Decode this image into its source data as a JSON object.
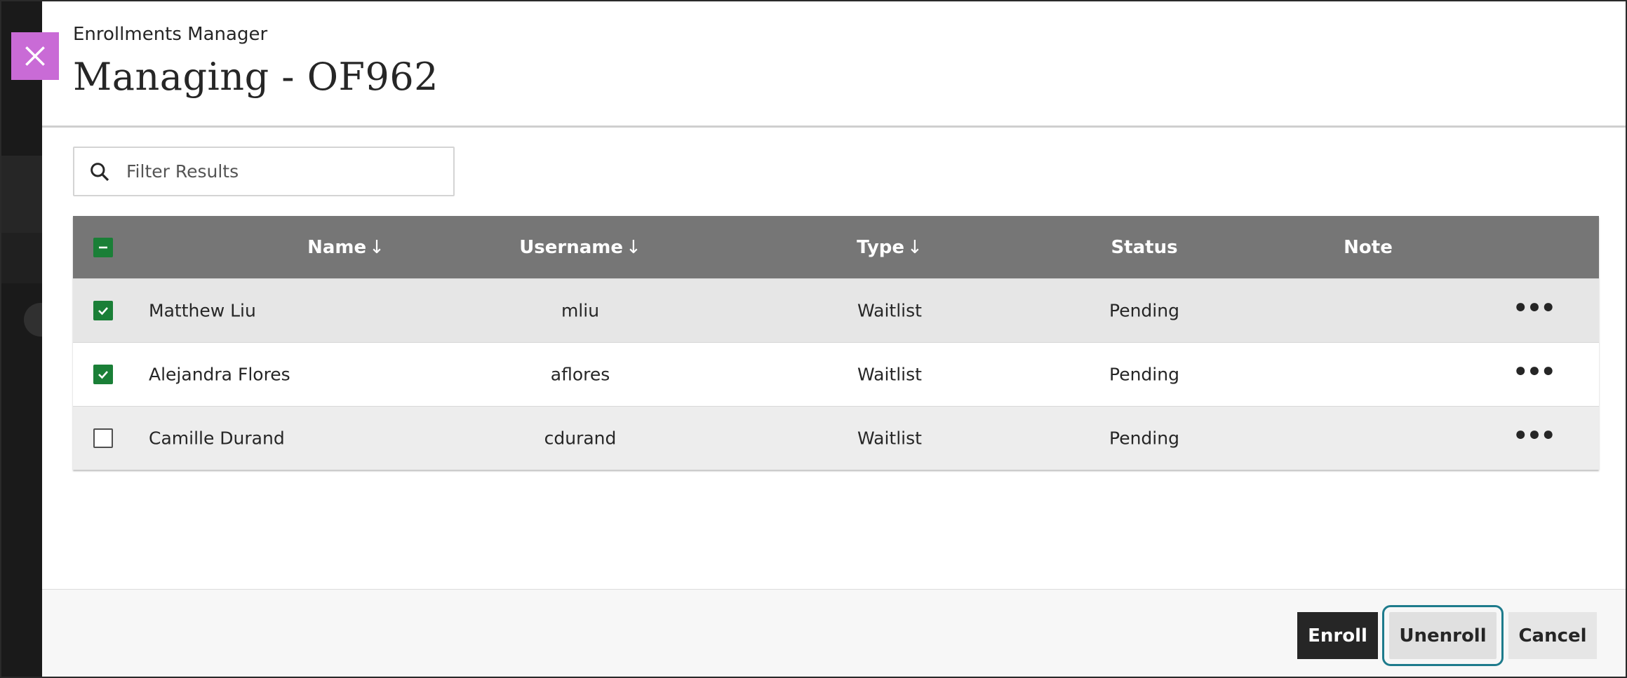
{
  "header": {
    "subtitle": "Enrollments Manager",
    "title": "Managing - OF962"
  },
  "filter": {
    "placeholder": "Filter Results",
    "value": ""
  },
  "table": {
    "columns": {
      "name": "Name",
      "username": "Username",
      "type": "Type",
      "status": "Status",
      "note": "Note"
    },
    "sort_arrow": "↓",
    "select_all_state": "indeterminate",
    "rows": [
      {
        "checked": true,
        "name": "Matthew Liu",
        "username": "mliu",
        "type": "Waitlist",
        "status": "Pending"
      },
      {
        "checked": true,
        "name": "Alejandra Flores",
        "username": "aflores",
        "type": "Waitlist",
        "status": "Pending"
      },
      {
        "checked": false,
        "name": "Camille Durand",
        "username": "cdurand",
        "type": "Waitlist",
        "status": "Pending"
      }
    ],
    "more_label": "•••"
  },
  "footer": {
    "enroll_label": "Enroll",
    "unenroll_label": "Unenroll",
    "cancel_label": "Cancel"
  },
  "colors": {
    "close_button": "#c96bd6",
    "checkbox_checked": "#1a7f37",
    "header_bg": "#767676",
    "focus_ring": "#1e7b8c"
  },
  "icons": {
    "close": "close-icon",
    "search": "search-icon",
    "more": "more-options-icon",
    "check": "check-icon"
  }
}
